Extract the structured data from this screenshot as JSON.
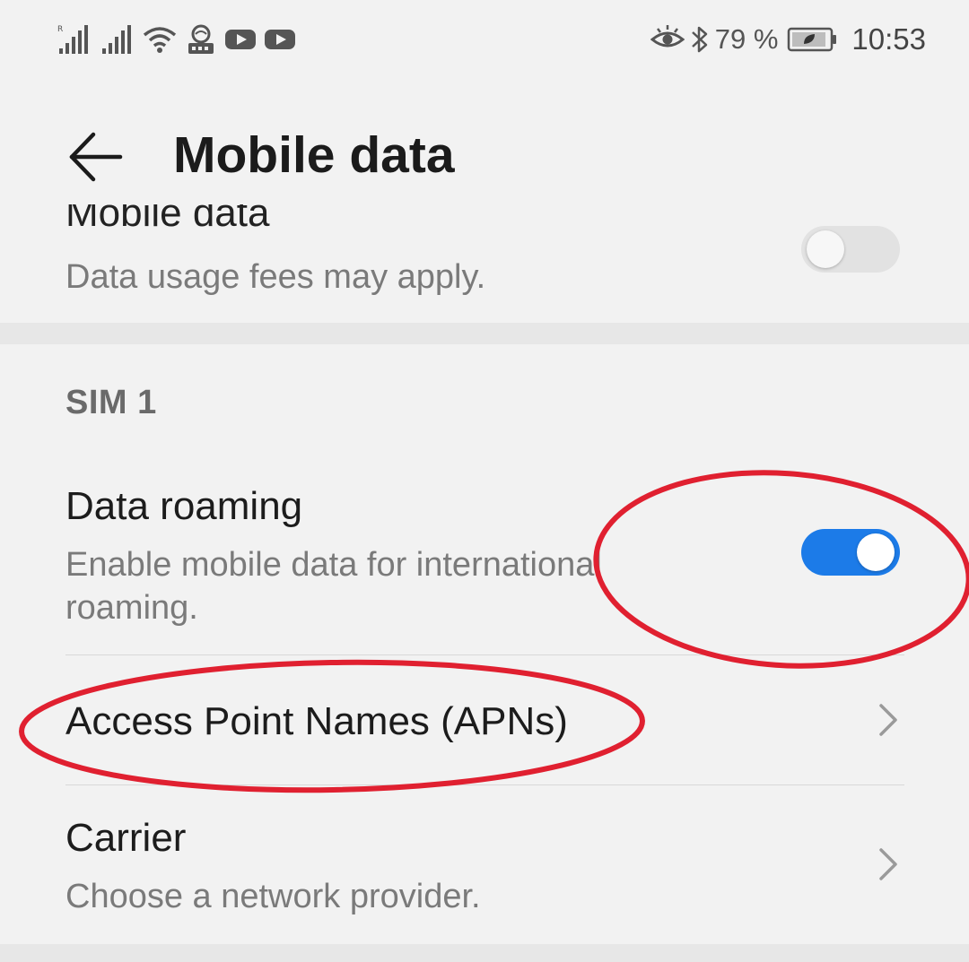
{
  "status_bar": {
    "battery_percent": "79 %",
    "time": "10:53",
    "icons": [
      "signal-roaming-icon",
      "signal-icon",
      "wifi-icon",
      "vpn-icon",
      "youtube-icon",
      "youtube-icon",
      "eye-comfort-icon",
      "bluetooth-icon",
      "battery-icon"
    ]
  },
  "header": {
    "title": "Mobile data"
  },
  "mobile_data_row": {
    "title": "Mobile data",
    "subtitle": "Data usage fees may apply.",
    "enabled": false
  },
  "sim_section": {
    "header": "SIM 1",
    "data_roaming": {
      "title": "Data roaming",
      "subtitle": "Enable mobile data for international roaming.",
      "enabled": true
    },
    "apn": {
      "title": "Access Point Names (APNs)"
    },
    "carrier": {
      "title": "Carrier",
      "subtitle": "Choose a network provider."
    }
  },
  "colors": {
    "accent": "#1c7be8",
    "annotation": "#e02030",
    "background": "#f2f2f2"
  }
}
